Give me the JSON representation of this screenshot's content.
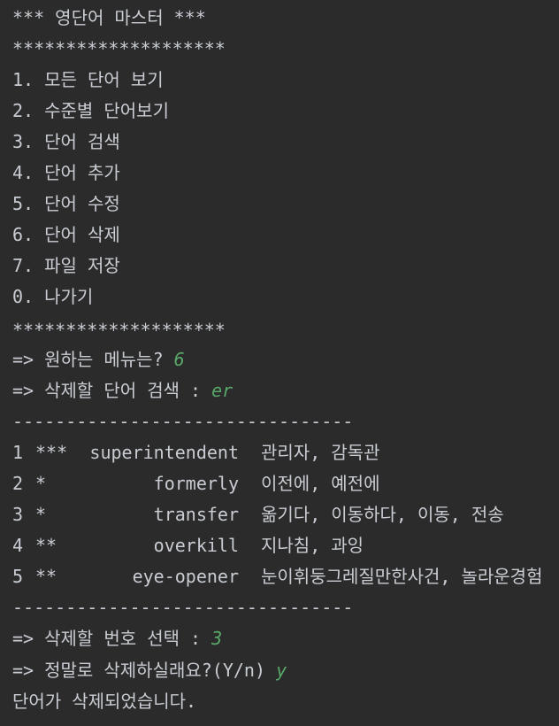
{
  "menu": {
    "title": "*** 영단어 마스터 ***",
    "divider": "********************",
    "items": [
      "1. 모든 단어 보기",
      "2. 수준별 단어보기",
      "3. 단어 검색",
      "4. 단어 추가",
      "5. 단어 수정",
      "6. 단어 삭제",
      "7. 파일 저장",
      "0. 나가기"
    ]
  },
  "prompts": {
    "menu_prompt": "=> 원하는 메뉴는? ",
    "menu_input": "6",
    "search_prompt": "=> 삭제할 단어 검색 : ",
    "search_input": "er",
    "select_prompt": "=> 삭제할 번호 선택 : ",
    "select_input": "3",
    "confirm_prompt": "=> 정말로 삭제하실래요?(Y/n) ",
    "confirm_input": "y"
  },
  "results": {
    "divider": "--------------------------------",
    "rows": [
      {
        "no": "1",
        "stars": "***",
        "word": "superintendent",
        "meaning": "관리자, 감독관"
      },
      {
        "no": "2",
        "stars": "*",
        "word": "formerly",
        "meaning": "이전에, 예전에"
      },
      {
        "no": "3",
        "stars": "*",
        "word": "transfer",
        "meaning": "옮기다, 이동하다, 이동, 전송"
      },
      {
        "no": "4",
        "stars": "**",
        "word": "overkill",
        "meaning": "지나침, 과잉"
      },
      {
        "no": "5",
        "stars": "**",
        "word": "eye-opener",
        "meaning": "눈이휘둥그레질만한사건, 놀라운경험"
      }
    ]
  },
  "status": {
    "deleted_message": "단어가 삭제되었습니다."
  },
  "colors": {
    "background": "#2b2b2b",
    "text": "#c9cdd3",
    "user_input": "#59a869"
  }
}
